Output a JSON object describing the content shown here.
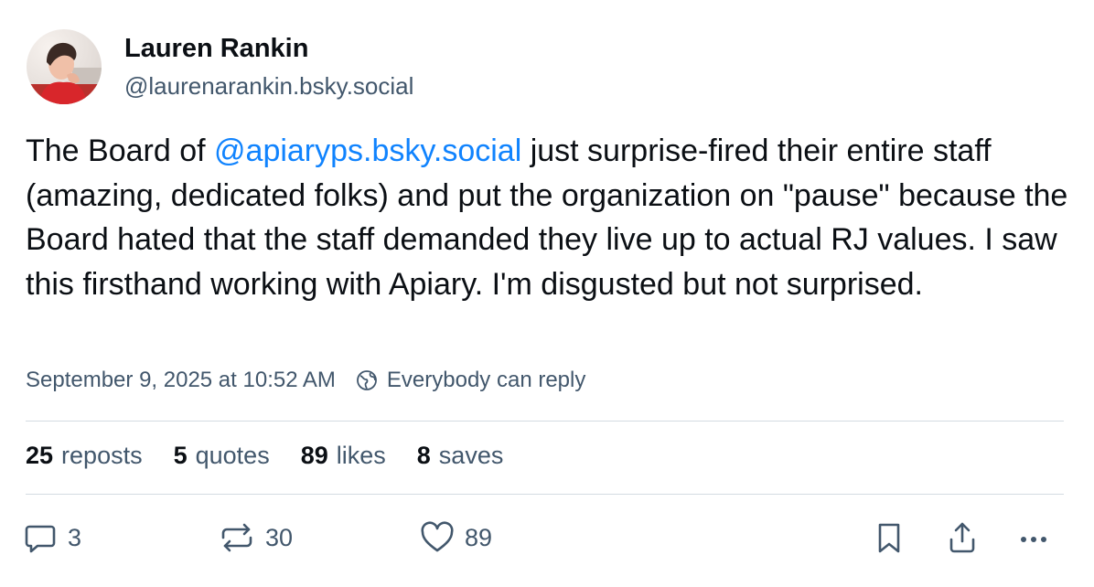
{
  "author": {
    "display_name": "Lauren Rankin",
    "handle": "@laurenarankin.bsky.social"
  },
  "post": {
    "text_before": "The Board of ",
    "mention": "@apiaryps.bsky.social",
    "text_after": " just surprise-fired their entire staff (amazing, dedicated folks) and put the organization on \"pause\" because the Board hated that the staff demanded they live up to actual RJ values. I saw this firsthand working with Apiary. I'm disgusted but not surprised.",
    "timestamp": "September 9, 2025 at 10:52 AM",
    "reply_setting": "Everybody can reply"
  },
  "stats": {
    "reposts_count": "25",
    "reposts_label": "reposts",
    "quotes_count": "5",
    "quotes_label": "quotes",
    "likes_count": "89",
    "likes_label": "likes",
    "saves_count": "8",
    "saves_label": "saves"
  },
  "actions": {
    "reply_count": "3",
    "repost_count": "30",
    "like_count": "89"
  },
  "colors": {
    "accent": "#1083fe",
    "muted": "#42576c",
    "divider": "#d4dbe2"
  }
}
